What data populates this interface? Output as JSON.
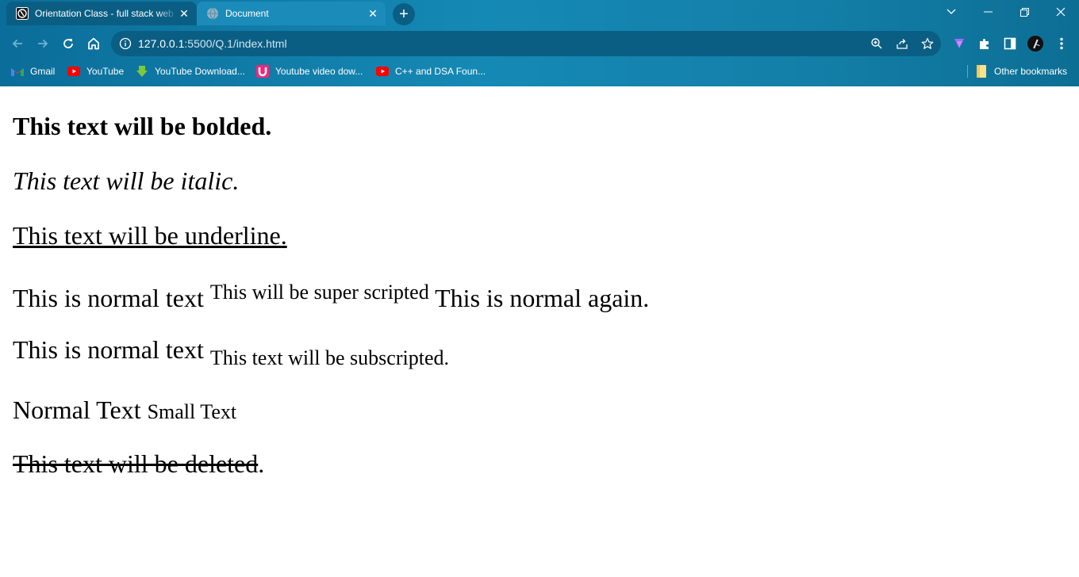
{
  "browser": {
    "tabs": [
      {
        "title": "Orientation Class - full stack web",
        "icon": "doc-favicon-icon",
        "active": false
      },
      {
        "title": "Document",
        "icon": "globe-icon",
        "active": true
      }
    ],
    "new_tab_label": "+",
    "address": {
      "host": "127.0.0.1",
      "rest": ":5500/Q.1/index.html"
    },
    "bookmarks": [
      {
        "label": "Gmail",
        "icon": "gmail-icon"
      },
      {
        "label": "YouTube",
        "icon": "youtube-icon"
      },
      {
        "label": "YouTube Download...",
        "icon": "download-arrow-icon"
      },
      {
        "label": "Youtube video dow...",
        "icon": "magnet-icon"
      },
      {
        "label": "C++ and DSA Foun...",
        "icon": "youtube-icon"
      }
    ],
    "other_bookmarks": "Other bookmarks"
  },
  "page": {
    "bold_text": "This text will be bolded.",
    "italic_text": "This text will be italic.",
    "underline_text": "This text will be underline.",
    "sup_line": {
      "normal": "This is normal text",
      "sup": "This will be super scripted",
      "after": "This is normal again."
    },
    "sub_line": {
      "normal": "This is normal text",
      "sub": "This text will be subscripted",
      "after": "."
    },
    "small_line": {
      "normal": "Normal Text",
      "small": "Small Text"
    },
    "deleted_line": {
      "deleted": "This text will be deleted",
      "after": "."
    }
  },
  "colors": {
    "chrome": "#1589b5",
    "active_tab": "#1b8cba",
    "omnibox": "#0b5e83"
  }
}
